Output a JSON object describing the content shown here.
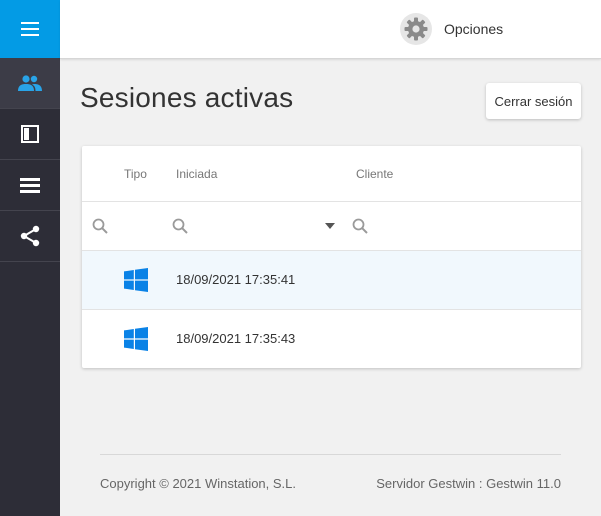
{
  "topbar": {
    "options_label": "Opciones"
  },
  "sidebar": {
    "menu_icon": "hamburger-menu-icon",
    "items": [
      {
        "icon": "users-icon",
        "active": true
      },
      {
        "icon": "window-icon",
        "active": false
      },
      {
        "icon": "list-icon",
        "active": false
      },
      {
        "icon": "share-icon",
        "active": false
      }
    ]
  },
  "page": {
    "title": "Sesiones activas",
    "logout_label": "Cerrar sesión"
  },
  "table": {
    "columns": [
      "Tipo",
      "Iniciada",
      "Cliente"
    ],
    "rows": [
      {
        "type_icon": "windows-icon",
        "started": "18/09/2021 17:35:41",
        "client": ""
      },
      {
        "type_icon": "windows-icon",
        "started": "18/09/2021 17:35:43",
        "client": ""
      }
    ]
  },
  "footer": {
    "copyright": "Copyright © 2021 Winstation, S.L.",
    "server": "Servidor Gestwin : Gestwin 11.0"
  },
  "colors": {
    "accent": "#039be5",
    "sidebar": "#2d2d37",
    "active_icon": "#29a4e8",
    "windows_blue": "#0a82e6",
    "selected_row": "#f1f8fd"
  }
}
